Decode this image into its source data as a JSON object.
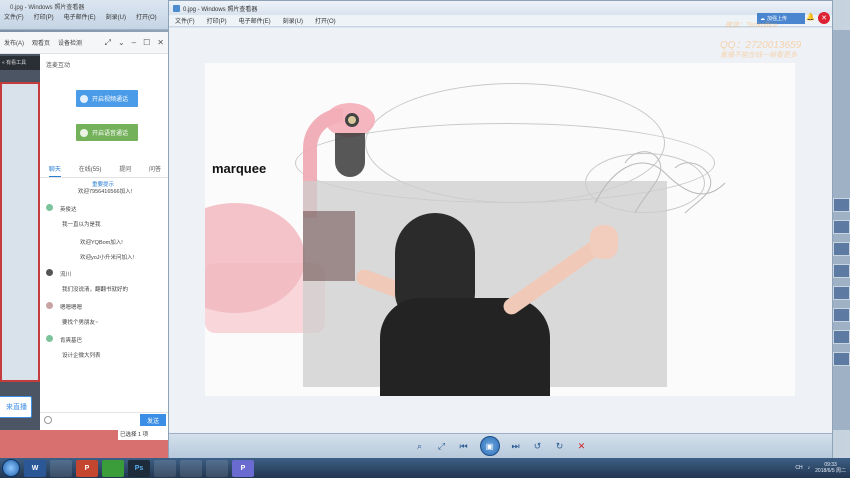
{
  "back_window": {
    "title": "0.jpg - Windows 照片查看器",
    "menu": [
      "文件(F)",
      "打印(P)",
      "电子邮件(E)",
      "刻录(U)",
      "打开(O)"
    ]
  },
  "chat_window": {
    "top_items": [
      "发布(A)",
      "观看页",
      "设备检测"
    ],
    "left_tab": "« 有看工具",
    "header": "连麦互动",
    "video_btn": "开启视频通话",
    "audio_btn": "开启语音通话",
    "tabs": [
      "聊天",
      "在线(55)",
      "提问",
      "问答"
    ],
    "messages": [
      {
        "kind": "system",
        "text": "欢迎7956416566加入!",
        "prefix": "重要提示"
      },
      {
        "kind": "name",
        "text": "英俊达"
      },
      {
        "kind": "text",
        "text": "我一直以为是我"
      },
      {
        "kind": "system",
        "text": "欢迎YQBom加入!"
      },
      {
        "kind": "system",
        "text": "欢迎yoJ小升米问加入!"
      },
      {
        "kind": "name",
        "text": "流川"
      },
      {
        "kind": "text",
        "text": "我们没说清，翻翻书就好的"
      },
      {
        "kind": "name",
        "text": "嗯嗯嗯嗯"
      },
      {
        "kind": "text",
        "text": "要找个男朋友~"
      },
      {
        "kind": "name",
        "text": "肯爽基巴"
      },
      {
        "kind": "text",
        "text": "设计企微大列表"
      }
    ],
    "send": "发送",
    "big_btn": "来直播"
  },
  "viewer": {
    "title": "0.jpg - Windows 照片查看器",
    "menu": [
      "文件(F)",
      "打印(P)",
      "电子邮件(E)",
      "刻录(U)",
      "打开(O)"
    ],
    "photo_text": "marquee"
  },
  "overlay": {
    "upload": "加强上传",
    "watermark_lines": [
      "微信：Tenkoffice",
      "QQ：2720013659",
      "直播不能在线一帧看更多"
    ]
  },
  "status": {
    "under_text": "已选择 1 项"
  },
  "taskbar": {
    "apps": [
      "W",
      "",
      "P",
      "",
      "Ps",
      "",
      "",
      "",
      "P"
    ],
    "tray_text": "CH",
    "time": "09:33",
    "date": "2018/6/5 周二"
  }
}
